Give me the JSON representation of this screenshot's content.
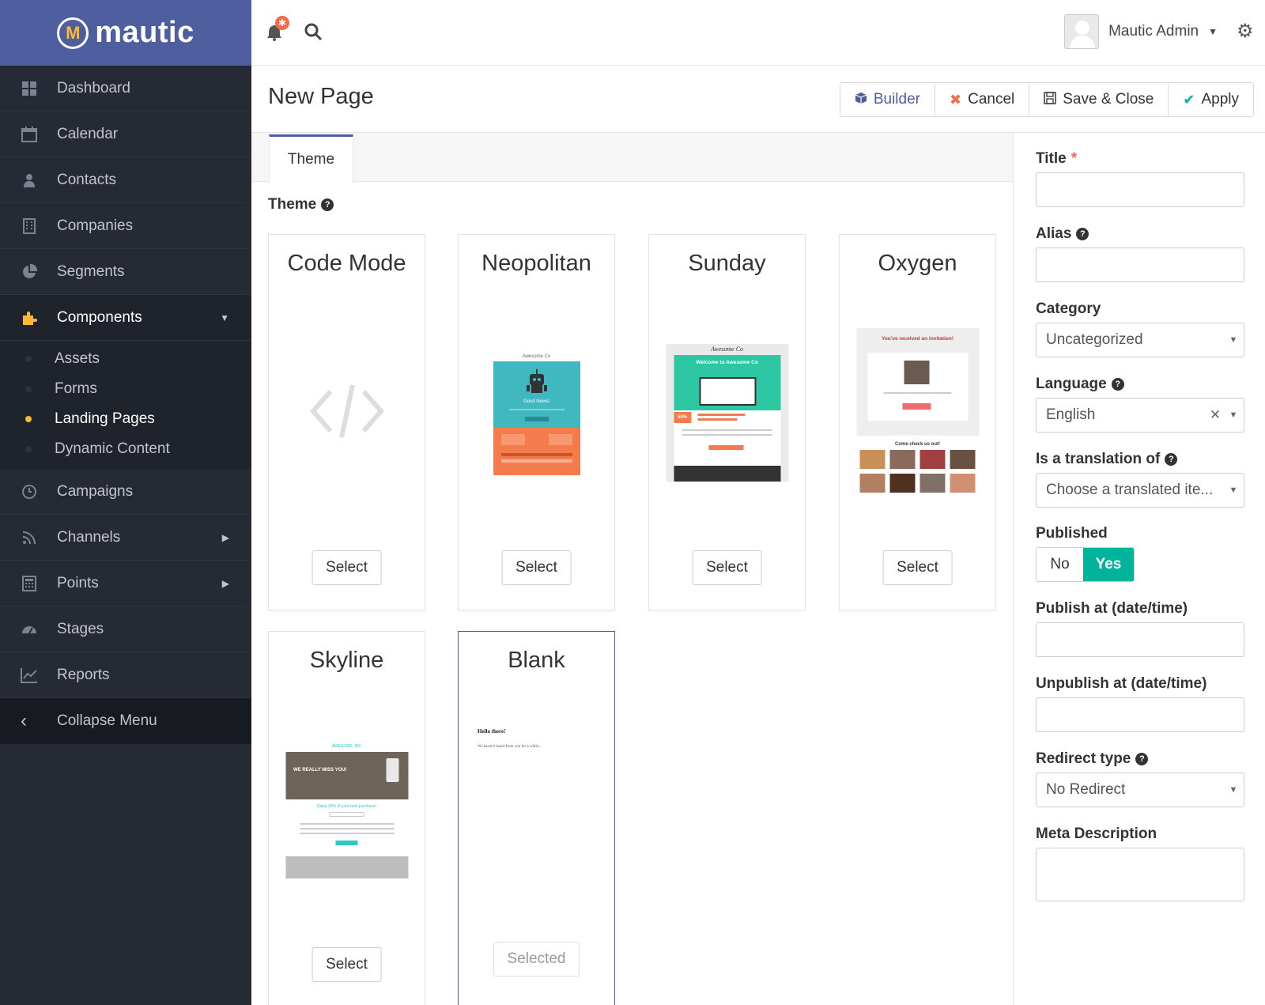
{
  "brand": {
    "name": "mautic",
    "logo_letter": "M"
  },
  "topbar": {
    "notification_count": "✱",
    "user_name": "Mautic Admin"
  },
  "sidebar": {
    "items": [
      {
        "label": "Dashboard",
        "icon": "dashboard-icon"
      },
      {
        "label": "Calendar",
        "icon": "calendar-icon"
      },
      {
        "label": "Contacts",
        "icon": "user-icon"
      },
      {
        "label": "Companies",
        "icon": "building-icon"
      },
      {
        "label": "Segments",
        "icon": "pie-chart-icon"
      },
      {
        "label": "Components",
        "icon": "puzzle-icon"
      },
      {
        "label": "Campaigns",
        "icon": "clock-icon"
      },
      {
        "label": "Channels",
        "icon": "rss-icon"
      },
      {
        "label": "Points",
        "icon": "calculator-icon"
      },
      {
        "label": "Stages",
        "icon": "tachometer-icon"
      },
      {
        "label": "Reports",
        "icon": "line-chart-icon"
      }
    ],
    "sub_items": [
      "Assets",
      "Forms",
      "Landing Pages",
      "Dynamic Content"
    ],
    "collapse_label": "Collapse Menu"
  },
  "header": {
    "title": "New Page",
    "buttons": {
      "builder": "Builder",
      "cancel": "Cancel",
      "save_close": "Save & Close",
      "apply": "Apply"
    }
  },
  "main": {
    "tab": "Theme",
    "section_label": "Theme",
    "themes": [
      {
        "name": "Code Mode",
        "button": "Select"
      },
      {
        "name": "Neopolitan",
        "button": "Select"
      },
      {
        "name": "Sunday",
        "button": "Select"
      },
      {
        "name": "Oxygen",
        "button": "Select"
      },
      {
        "name": "Skyline",
        "button": "Select"
      },
      {
        "name": "Blank",
        "button": "Selected"
      }
    ],
    "thumb_text": {
      "neo_top": "Awesome Co",
      "neo_news": "Good News!",
      "sunday_brand": "Awesome Co",
      "sunday_welcome": "Welcome to Awesome Co",
      "sunday_pct": "50%",
      "oxygen_heading": "You've received an invitation!",
      "oxygen_check": "Come check us out!",
      "skyline_brand": "AWESOME, INC",
      "skyline_hero": "WE REALLY MISS YOU!",
      "skyline_offer": "Enjoy 30% of your next purchase!",
      "blank_hello": "Hello there!",
      "blank_body": "We haven't heard from you for a while..."
    }
  },
  "side": {
    "title_label": "Title",
    "required_mark": "*",
    "alias_label": "Alias",
    "category_label": "Category",
    "category_value": "Uncategorized",
    "language_label": "Language",
    "language_value": "English",
    "translation_label": "Is a translation of",
    "translation_placeholder": "Choose a translated ite...",
    "published_label": "Published",
    "published_no": "No",
    "published_yes": "Yes",
    "publish_at_label": "Publish at (date/time)",
    "unpublish_at_label": "Unpublish at (date/time)",
    "redirect_label": "Redirect type",
    "redirect_value": "No Redirect",
    "meta_label": "Meta Description"
  },
  "colors": {
    "brand": "#4e5e9e",
    "sidebar": "#252a35",
    "accent": "#fdb933",
    "success": "#00b49c",
    "danger": "#f06c4a"
  }
}
